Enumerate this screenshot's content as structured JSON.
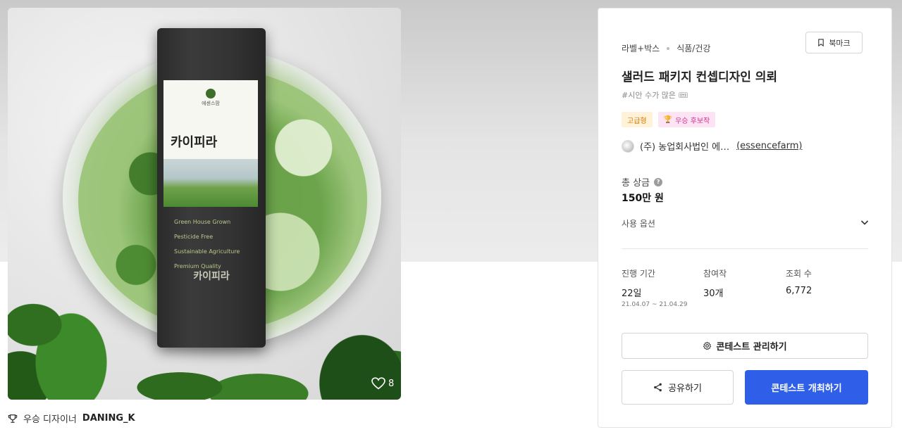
{
  "hero": {
    "package": {
      "brand": "에센스팜",
      "small_text": "",
      "product_name": "카이피라",
      "features": [
        "Green House Grown",
        "Pesticide Free",
        "Sustainable Agriculture",
        "Premium Quality"
      ],
      "product_name_bottom": "카이피라"
    },
    "likes": "8"
  },
  "winner": {
    "prefix": "우승 디자이너",
    "name": "DANING_K"
  },
  "panel": {
    "category_primary": "라벨+박스",
    "category_secondary": "식품/건강",
    "bookmark_label": "북마크",
    "title": "샐러드 패키지 컨셉디자인 의뢰",
    "tag": "#시안 수가 많은 🎟",
    "badges": {
      "premium": "고급형",
      "candidate": "우승 후보작"
    },
    "host_name": "(주) 농업회사법인 에…",
    "host_id": "(essencefarm)",
    "prize_label": "총 상금",
    "prize_value": "150만 원",
    "options_label": "사용 옵션",
    "stats": {
      "duration_label": "진행 기간",
      "duration_value": "22일",
      "duration_range": "21.04.07 ~ 21.04.29",
      "entries_label": "참여작",
      "entries_value": "30개",
      "views_label": "조회 수",
      "views_value": "6,772"
    },
    "manage_label": "콘테스트 관리하기",
    "share_label": "공유하기",
    "host_contest_label": "콘테스트 개최하기"
  },
  "colors": {
    "primary_button": "#2f5fe8",
    "premium_badge_bg": "#fff2d9",
    "premium_badge_text": "#d77a00",
    "candidate_badge_bg": "#fde4f4",
    "candidate_badge_text": "#d0328f"
  },
  "icons": {
    "bookmark": "bookmark-icon",
    "info": "info-icon",
    "chevron": "chevron-down-icon",
    "gear": "gear-icon",
    "share": "share-icon",
    "trophy": "trophy-icon",
    "heart": "heart-icon"
  }
}
